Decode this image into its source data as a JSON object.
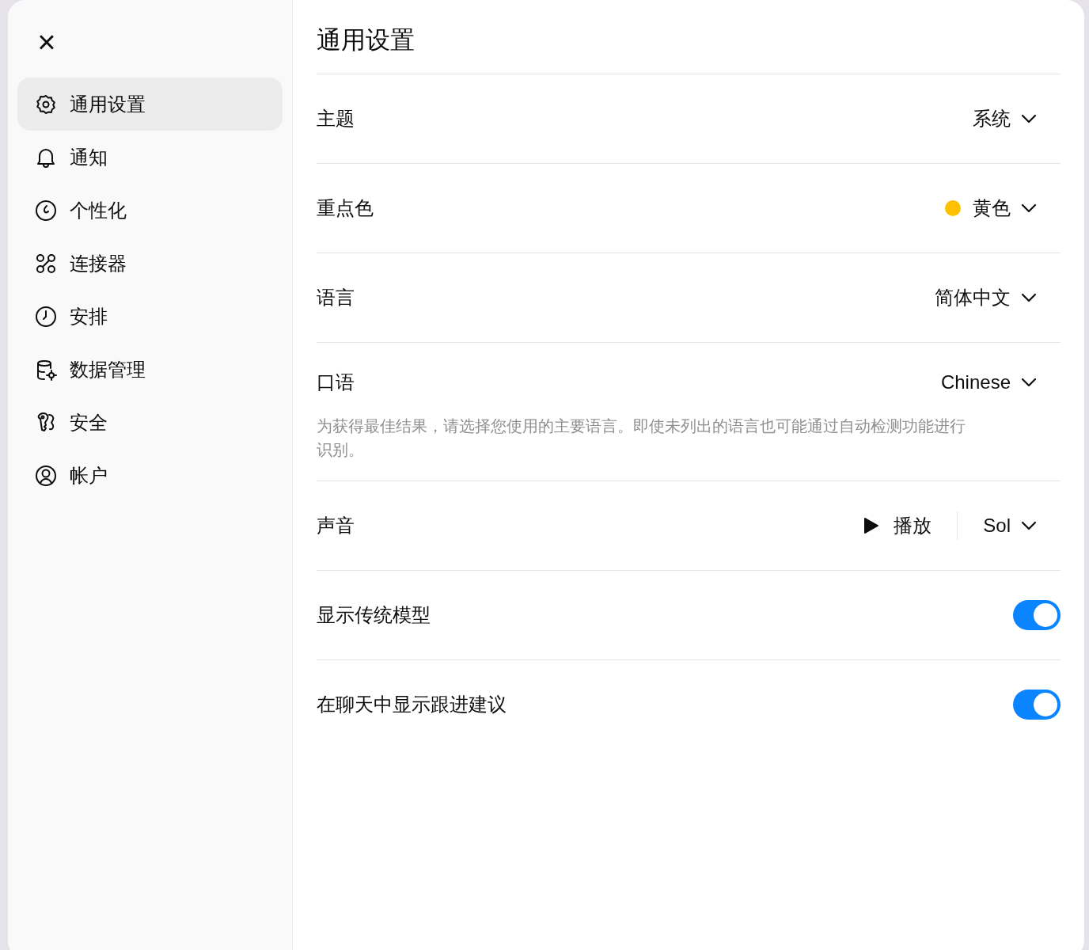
{
  "close_label": "×",
  "sidebar": {
    "items": [
      {
        "label": "通用设置",
        "selected": true
      },
      {
        "label": "通知",
        "selected": false
      },
      {
        "label": "个性化",
        "selected": false
      },
      {
        "label": "连接器",
        "selected": false
      },
      {
        "label": "安排",
        "selected": false
      },
      {
        "label": "数据管理",
        "selected": false
      },
      {
        "label": "安全",
        "selected": false
      },
      {
        "label": "帐户",
        "selected": false
      }
    ]
  },
  "title": "通用设置",
  "rows": [
    {
      "kind": "select",
      "label": "主题",
      "value": "系统"
    },
    {
      "kind": "select",
      "label": "重点色",
      "value": "黄色",
      "color": "#ffc000"
    },
    {
      "kind": "select",
      "label": "语言",
      "value": "简体中文"
    },
    {
      "kind": "select",
      "label": "口语",
      "value": "Chinese",
      "hint": "为获得最佳结果，请选择您使用的主要语言。即使未列出的语言也可能通过自动检测功能进行识别。"
    },
    {
      "kind": "sound",
      "label": "声音",
      "play": "播放",
      "value": "Sol"
    },
    {
      "kind": "toggle",
      "label": "显示传统模型",
      "on": true
    },
    {
      "kind": "toggle",
      "label": "在聊天中显示跟进建议",
      "on": true
    }
  ]
}
